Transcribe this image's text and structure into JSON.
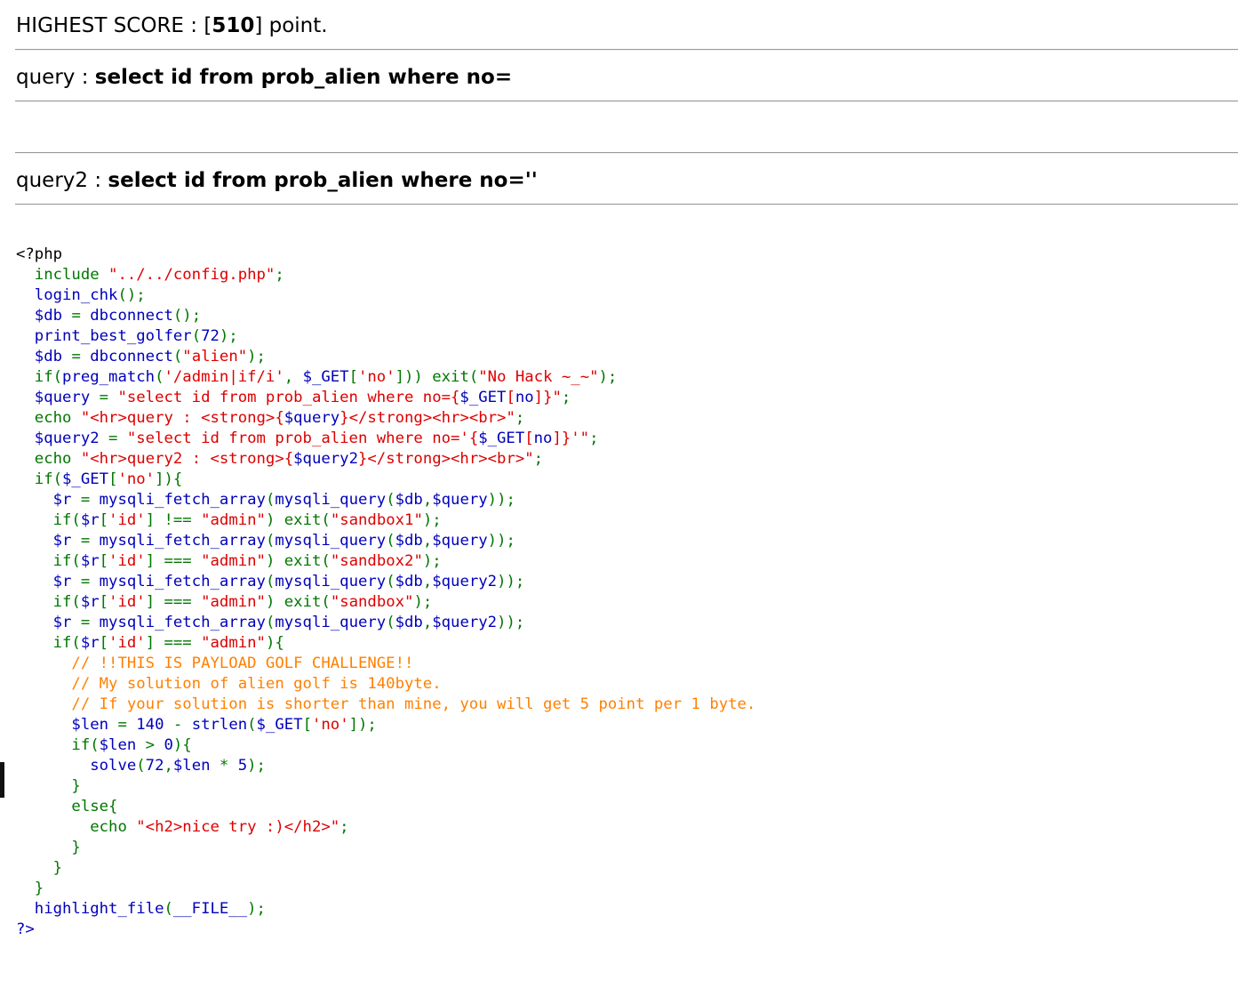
{
  "score": {
    "prefix": "HIGHEST SCORE : [",
    "value": "510",
    "suffix": "] point."
  },
  "query1": {
    "label": "query : ",
    "value": "select id from prob_alien where no="
  },
  "query2": {
    "label": "query2 : ",
    "value": "select id from prob_alien where no=''"
  },
  "colors": {
    "html": "#000000",
    "default": "#0000BB",
    "keyword": "#007700",
    "string": "#DD0000",
    "comment": "#FF8000"
  },
  "source_lines": [
    [
      [
        "html",
        "<?php"
      ]
    ],
    [
      [
        "keyword",
        "  include "
      ],
      [
        "string",
        "\"../../config.php\""
      ],
      [
        "keyword",
        ";"
      ]
    ],
    [
      [
        "default",
        "  login_chk"
      ],
      [
        "keyword",
        "();"
      ]
    ],
    [
      [
        "default",
        "  $db "
      ],
      [
        "keyword",
        "= "
      ],
      [
        "default",
        "dbconnect"
      ],
      [
        "keyword",
        "();"
      ]
    ],
    [
      [
        "default",
        "  print_best_golfer"
      ],
      [
        "keyword",
        "("
      ],
      [
        "default",
        "72"
      ],
      [
        "keyword",
        ");"
      ]
    ],
    [
      [
        "default",
        "  $db "
      ],
      [
        "keyword",
        "= "
      ],
      [
        "default",
        "dbconnect"
      ],
      [
        "keyword",
        "("
      ],
      [
        "string",
        "\"alien\""
      ],
      [
        "keyword",
        ");"
      ]
    ],
    [
      [
        "keyword",
        "  if("
      ],
      [
        "default",
        "preg_match"
      ],
      [
        "keyword",
        "("
      ],
      [
        "string",
        "'/admin|if/i'"
      ],
      [
        "keyword",
        ", "
      ],
      [
        "default",
        "$_GET"
      ],
      [
        "keyword",
        "["
      ],
      [
        "string",
        "'no'"
      ],
      [
        "keyword",
        "])) exit("
      ],
      [
        "string",
        "\"No Hack ~_~\""
      ],
      [
        "keyword",
        ");"
      ]
    ],
    [
      [
        "default",
        "  $query "
      ],
      [
        "keyword",
        "= "
      ],
      [
        "string",
        "\"select id from prob_alien where no={"
      ],
      [
        "default",
        "$_GET"
      ],
      [
        "string",
        "["
      ],
      [
        "default",
        "no"
      ],
      [
        "string",
        "]}\""
      ],
      [
        "keyword",
        ";"
      ]
    ],
    [
      [
        "keyword",
        "  echo "
      ],
      [
        "string",
        "\"<hr>query : <strong>{"
      ],
      [
        "default",
        "$query"
      ],
      [
        "string",
        "}</strong><hr><br>\""
      ],
      [
        "keyword",
        ";"
      ]
    ],
    [
      [
        "default",
        "  $query2 "
      ],
      [
        "keyword",
        "= "
      ],
      [
        "string",
        "\"select id from prob_alien where no='{"
      ],
      [
        "default",
        "$_GET"
      ],
      [
        "string",
        "["
      ],
      [
        "default",
        "no"
      ],
      [
        "string",
        "]}'\""
      ],
      [
        "keyword",
        ";"
      ]
    ],
    [
      [
        "keyword",
        "  echo "
      ],
      [
        "string",
        "\"<hr>query2 : <strong>{"
      ],
      [
        "default",
        "$query2"
      ],
      [
        "string",
        "}</strong><hr><br>\""
      ],
      [
        "keyword",
        ";"
      ]
    ],
    [
      [
        "keyword",
        "  if("
      ],
      [
        "default",
        "$_GET"
      ],
      [
        "keyword",
        "["
      ],
      [
        "string",
        "'no'"
      ],
      [
        "keyword",
        "]){"
      ]
    ],
    [
      [
        "default",
        "    $r "
      ],
      [
        "keyword",
        "= "
      ],
      [
        "default",
        "mysqli_fetch_array"
      ],
      [
        "keyword",
        "("
      ],
      [
        "default",
        "mysqli_query"
      ],
      [
        "keyword",
        "("
      ],
      [
        "default",
        "$db"
      ],
      [
        "keyword",
        ","
      ],
      [
        "default",
        "$query"
      ],
      [
        "keyword",
        "));"
      ]
    ],
    [
      [
        "keyword",
        "    if("
      ],
      [
        "default",
        "$r"
      ],
      [
        "keyword",
        "["
      ],
      [
        "string",
        "'id'"
      ],
      [
        "keyword",
        "] !== "
      ],
      [
        "string",
        "\"admin\""
      ],
      [
        "keyword",
        ") exit("
      ],
      [
        "string",
        "\"sandbox1\""
      ],
      [
        "keyword",
        ");"
      ]
    ],
    [
      [
        "default",
        "    $r "
      ],
      [
        "keyword",
        "= "
      ],
      [
        "default",
        "mysqli_fetch_array"
      ],
      [
        "keyword",
        "("
      ],
      [
        "default",
        "mysqli_query"
      ],
      [
        "keyword",
        "("
      ],
      [
        "default",
        "$db"
      ],
      [
        "keyword",
        ","
      ],
      [
        "default",
        "$query"
      ],
      [
        "keyword",
        "));"
      ]
    ],
    [
      [
        "keyword",
        "    if("
      ],
      [
        "default",
        "$r"
      ],
      [
        "keyword",
        "["
      ],
      [
        "string",
        "'id'"
      ],
      [
        "keyword",
        "] === "
      ],
      [
        "string",
        "\"admin\""
      ],
      [
        "keyword",
        ") exit("
      ],
      [
        "string",
        "\"sandbox2\""
      ],
      [
        "keyword",
        ");"
      ]
    ],
    [
      [
        "default",
        "    $r "
      ],
      [
        "keyword",
        "= "
      ],
      [
        "default",
        "mysqli_fetch_array"
      ],
      [
        "keyword",
        "("
      ],
      [
        "default",
        "mysqli_query"
      ],
      [
        "keyword",
        "("
      ],
      [
        "default",
        "$db"
      ],
      [
        "keyword",
        ","
      ],
      [
        "default",
        "$query2"
      ],
      [
        "keyword",
        "));"
      ]
    ],
    [
      [
        "keyword",
        "    if("
      ],
      [
        "default",
        "$r"
      ],
      [
        "keyword",
        "["
      ],
      [
        "string",
        "'id'"
      ],
      [
        "keyword",
        "] === "
      ],
      [
        "string",
        "\"admin\""
      ],
      [
        "keyword",
        ") exit("
      ],
      [
        "string",
        "\"sandbox\""
      ],
      [
        "keyword",
        ");"
      ]
    ],
    [
      [
        "default",
        "    $r "
      ],
      [
        "keyword",
        "= "
      ],
      [
        "default",
        "mysqli_fetch_array"
      ],
      [
        "keyword",
        "("
      ],
      [
        "default",
        "mysqli_query"
      ],
      [
        "keyword",
        "("
      ],
      [
        "default",
        "$db"
      ],
      [
        "keyword",
        ","
      ],
      [
        "default",
        "$query2"
      ],
      [
        "keyword",
        "));"
      ]
    ],
    [
      [
        "keyword",
        "    if("
      ],
      [
        "default",
        "$r"
      ],
      [
        "keyword",
        "["
      ],
      [
        "string",
        "'id'"
      ],
      [
        "keyword",
        "] === "
      ],
      [
        "string",
        "\"admin\""
      ],
      [
        "keyword",
        "){"
      ]
    ],
    [
      [
        "comment",
        "      // !!THIS IS PAYLOAD GOLF CHALLENGE!!"
      ]
    ],
    [
      [
        "comment",
        "      // My solution of alien golf is 140byte."
      ]
    ],
    [
      [
        "comment",
        "      // If your solution is shorter than mine, you will get 5 point per 1 byte."
      ]
    ],
    [
      [
        "default",
        "      $len "
      ],
      [
        "keyword",
        "= "
      ],
      [
        "default",
        "140 "
      ],
      [
        "keyword",
        "- "
      ],
      [
        "default",
        "strlen"
      ],
      [
        "keyword",
        "("
      ],
      [
        "default",
        "$_GET"
      ],
      [
        "keyword",
        "["
      ],
      [
        "string",
        "'no'"
      ],
      [
        "keyword",
        "]);"
      ]
    ],
    [
      [
        "keyword",
        "      if("
      ],
      [
        "default",
        "$len "
      ],
      [
        "keyword",
        "> "
      ],
      [
        "default",
        "0"
      ],
      [
        "keyword",
        "){"
      ]
    ],
    [
      [
        "default",
        "        solve"
      ],
      [
        "keyword",
        "("
      ],
      [
        "default",
        "72"
      ],
      [
        "keyword",
        ","
      ],
      [
        "default",
        "$len "
      ],
      [
        "keyword",
        "* "
      ],
      [
        "default",
        "5"
      ],
      [
        "keyword",
        ");"
      ]
    ],
    [
      [
        "keyword",
        "      }"
      ]
    ],
    [
      [
        "keyword",
        "      else{"
      ]
    ],
    [
      [
        "keyword",
        "        echo "
      ],
      [
        "string",
        "\"<h2>nice try :)</h2>\""
      ],
      [
        "keyword",
        ";"
      ]
    ],
    [
      [
        "keyword",
        "      }"
      ]
    ],
    [
      [
        "keyword",
        "    }"
      ]
    ],
    [
      [
        "keyword",
        "  }"
      ]
    ],
    [
      [
        "default",
        "  highlight_file"
      ],
      [
        "keyword",
        "("
      ],
      [
        "default",
        "__FILE__"
      ],
      [
        "keyword",
        ");"
      ]
    ],
    [
      [
        "default",
        "?>"
      ]
    ]
  ]
}
